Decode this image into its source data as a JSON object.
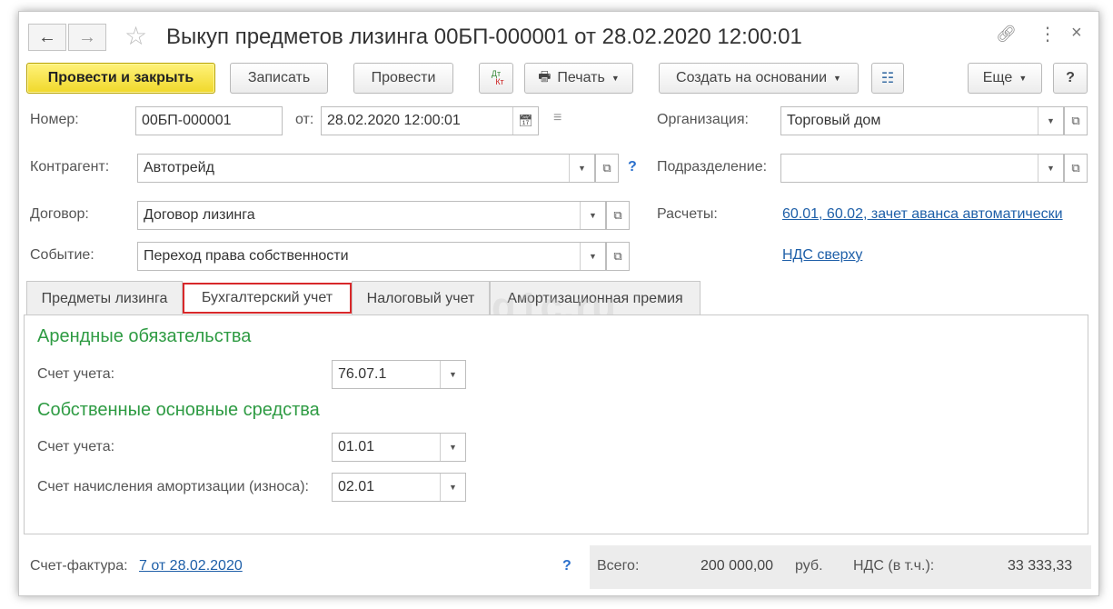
{
  "title": "Выкуп предметов лизинга 00БП-000001 от 28.02.2020 12:00:01",
  "toolbar": {
    "post_close": "Провести и закрыть",
    "save": "Записать",
    "post": "Провести",
    "dtkt_dt": "Дт",
    "dtkt_kt": "Кт",
    "print": "Печать",
    "create_based": "Создать на основании",
    "more": "Еще",
    "help": "?"
  },
  "form": {
    "number_label": "Номер:",
    "number_value": "00БП-000001",
    "from_label": "от:",
    "date_value": "28.02.2020 12:00:01",
    "org_label": "Организация:",
    "org_value": "Торговый дом",
    "counterparty_label": "Контрагент:",
    "counterparty_value": "Автотрейд",
    "counterparty_help": "?",
    "subdivision_label": "Подразделение:",
    "subdivision_value": "",
    "contract_label": "Договор:",
    "contract_value": "Договор лизинга",
    "settlements_label": "Расчеты:",
    "settlements_link": "60.01, 60.02, зачет аванса автоматически",
    "event_label": "Событие:",
    "event_value": "Переход права собственности",
    "vat_link": "НДС сверху"
  },
  "tabs": [
    {
      "label": "Предметы лизинга"
    },
    {
      "label": "Бухгалтерский учет"
    },
    {
      "label": "Налоговый учет"
    },
    {
      "label": "Амортизационная премия"
    }
  ],
  "watermark": "q1c.ru",
  "accounting": {
    "lease_section": "Арендные обязательства",
    "lease_account_label": "Счет учета:",
    "lease_account_value": "76.07.1",
    "own_section": "Собственные основные средства",
    "own_account_label": "Счет учета:",
    "own_account_value": "01.01",
    "depr_label": "Счет начисления амортизации (износа):",
    "depr_value": "02.01"
  },
  "footer": {
    "invoice_label": "Счет-фактура:",
    "invoice_link": "7 от 28.02.2020",
    "help": "?",
    "total_label": "Всего:",
    "total_value": "200 000,00",
    "currency": "руб.",
    "vat_label": "НДС (в т.ч.):",
    "vat_value": "33 333,33"
  }
}
